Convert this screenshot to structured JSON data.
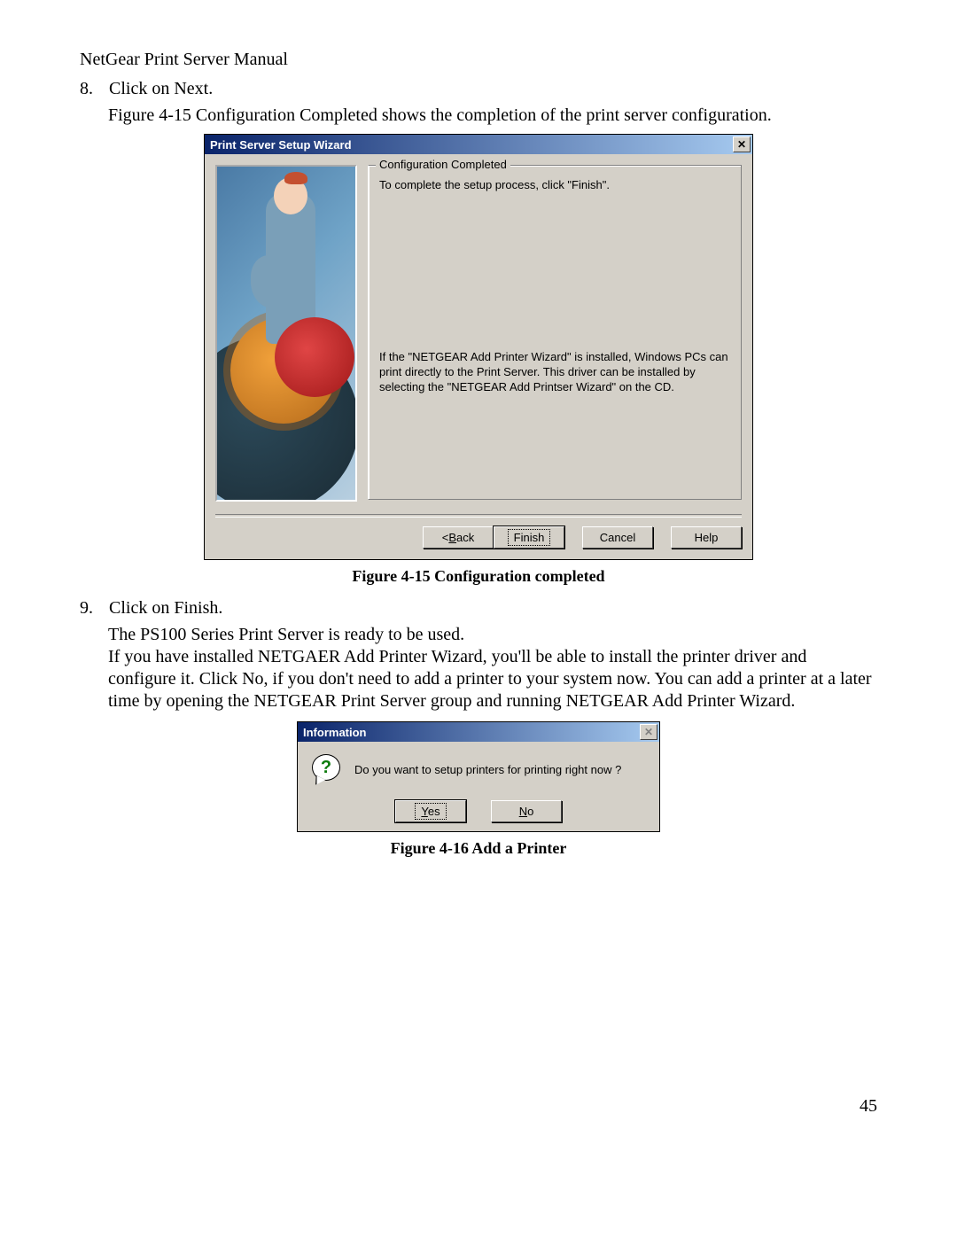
{
  "doc": {
    "header": "NetGear Print Server Manual",
    "page_number": "45"
  },
  "steps": {
    "s8": {
      "num": "8.",
      "text": "Click on Next.",
      "desc": "Figure 4-15 Configuration Completed shows the completion of the print server configuration."
    },
    "s9": {
      "num": "9.",
      "text": "Click on Finish.",
      "desc1": "The PS100 Series Print Server is ready to be used.",
      "desc2": "If you have installed NETGAER Add Printer Wizard, you'll be able to install the printer driver and configure it. Click No, if you don't need to add a printer to your system now. You can add a printer at a later time by opening the NETGEAR Print Server group and running NETGEAR Add Printer Wizard."
    }
  },
  "wizard": {
    "title": "Print Server Setup Wizard",
    "group_title": "Configuration Completed",
    "top_text": "To complete the setup process, click \"Finish\".",
    "bottom_text": "If the \"NETGEAR Add Printer Wizard\" is installed, Windows PCs can print directly to the Print Server. This driver can be installed by selecting the \"NETGEAR Add Printser Wizard\" on the CD.",
    "buttons": {
      "back_prefix": "< ",
      "back_u": "B",
      "back_suffix": "ack",
      "finish": "Finish",
      "cancel": "Cancel",
      "help": "Help"
    },
    "caption": "Figure 4-15 Configuration completed"
  },
  "info": {
    "title": "Information",
    "message": "Do you want to setup printers for printing right now ?",
    "buttons": {
      "yes_u": "Y",
      "yes_suffix": "es",
      "no_u": "N",
      "no_suffix": "o"
    },
    "caption": "Figure 4-16 Add a Printer"
  }
}
